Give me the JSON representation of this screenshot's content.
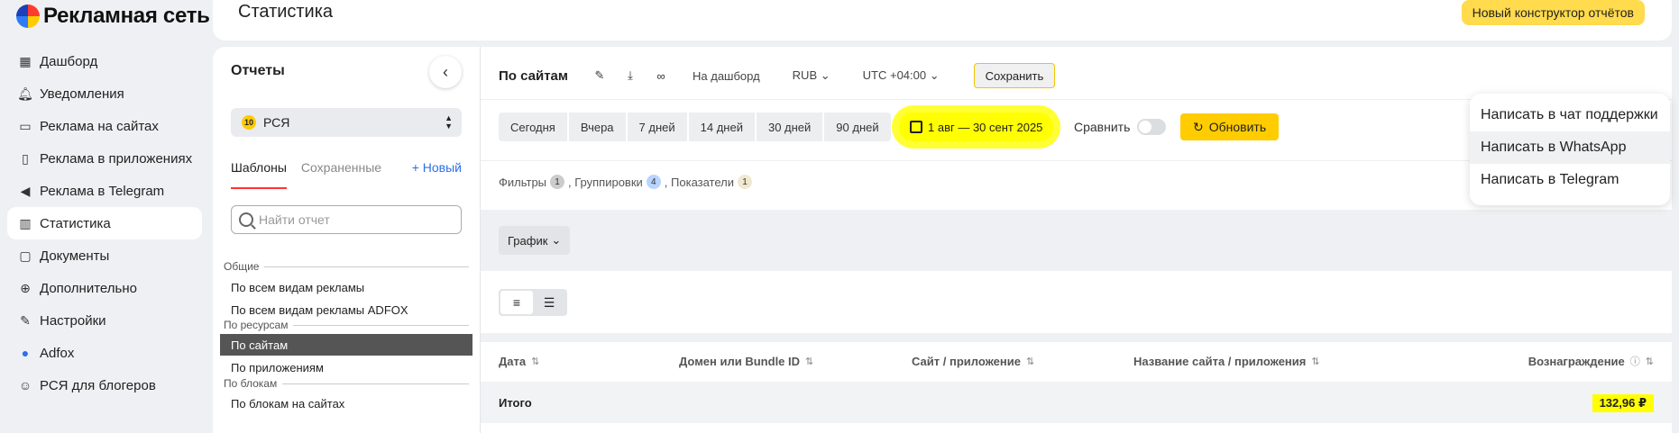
{
  "app": {
    "logo_text": "Рекламная сеть",
    "page_title": "Статистика",
    "new_constructor_label": "Новый конструктор отчётов"
  },
  "nav": {
    "items": [
      {
        "label": "Дашборд",
        "icon": "dashboard-icon"
      },
      {
        "label": "Уведомления",
        "icon": "bell-icon"
      },
      {
        "label": "Реклама на сайтах",
        "icon": "monitor-icon"
      },
      {
        "label": "Реклама в приложениях",
        "icon": "phone-icon"
      },
      {
        "label": "Реклама в Telegram",
        "icon": "megaphone-icon"
      },
      {
        "label": "Статистика",
        "icon": "chart-icon"
      },
      {
        "label": "Документы",
        "icon": "document-icon"
      },
      {
        "label": "Дополнительно",
        "icon": "plus-circle-icon"
      },
      {
        "label": "Настройки",
        "icon": "wrench-icon"
      },
      {
        "label": "Adfox",
        "icon": "adfox-icon"
      },
      {
        "label": "РСЯ для блогеров",
        "icon": "smile-icon"
      }
    ],
    "active": "Статистика"
  },
  "reports": {
    "title": "Отчеты",
    "select_value": "РСЯ",
    "select_badge": "10",
    "tab_templates": "Шаблоны",
    "tab_saved": "Сохраненные",
    "new_label": "+ Новый",
    "search_placeholder": "Найти отчет",
    "groups": {
      "common": "Общие",
      "by_resources": "По ресурсам",
      "by_blocks": "По блокам"
    },
    "items": {
      "all_ads": "По всем видам рекламы",
      "all_ads_adfox": "По всем видам рекламы ADFOX",
      "by_sites": "По сайтам",
      "by_apps": "По приложениям",
      "by_blocks_sites": "По блокам на сайтах"
    }
  },
  "toolbar": {
    "title": "По сайтам",
    "to_dashboard": "На дашборд",
    "currency": "RUB",
    "timezone": "UTC +04:00",
    "save_label": "Сохранить"
  },
  "periods": [
    "Сегодня",
    "Вчера",
    "7 дней",
    "14 дней",
    "30 дней",
    "90 дней"
  ],
  "date_range": "1 авг — 30 сент 2025",
  "compare_label": "Сравнить",
  "refresh_label": "Обновить",
  "filters": {
    "filters_label": "Фильтры",
    "filters_count": "1",
    "groupings_label": ", Группировки",
    "groupings_count": "4",
    "metrics_label": ", Показатели",
    "metrics_count": "1"
  },
  "chart_button": "График",
  "table": {
    "columns": [
      "Дата",
      "Домен или Bundle ID",
      "Сайт / приложение",
      "Название сайта / приложения",
      "Вознаграждение"
    ],
    "total_label": "Итого",
    "total_value": "132,96 ₽"
  },
  "support": {
    "items": [
      "Написать в чат поддержки",
      "Написать в WhatsApp",
      "Написать в Telegram"
    ]
  }
}
